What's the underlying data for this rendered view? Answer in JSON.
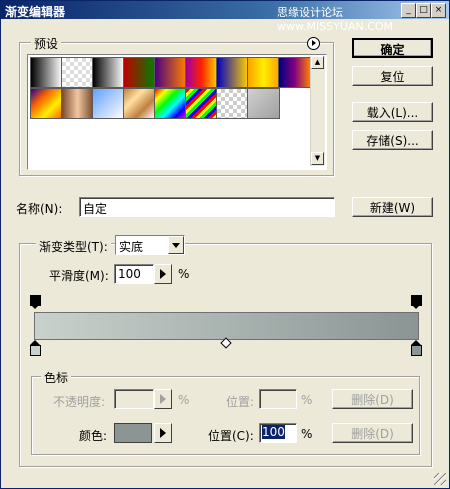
{
  "window": {
    "title": "渐变编辑器",
    "watermark": "思缘设计论坛  www.MISSYUAN.COM",
    "controls": {
      "minimize": "_",
      "maximize": "□",
      "close": "×"
    }
  },
  "presets": {
    "label": "预设",
    "menu_icon": "circle-arrow-icon",
    "swatches": [
      "linear-gradient(to right,#000,#fff)",
      "repeating-conic-gradient(#ddd 0 25%,#fff 0 50%) 0 0/8px 8px",
      "linear-gradient(to right,#000,#fff)",
      "linear-gradient(to right,#c00000,#008000)",
      "linear-gradient(to right,#4b0082,#ff7f00)",
      "linear-gradient(to right,#a000a0,#ff2000,#ffd000)",
      "linear-gradient(to right,#0000c0,#ffd000)",
      "linear-gradient(to right,#ffa000,#ffee00,#ffa000)",
      "linear-gradient(to right,#000080,#800080,#ff8000)",
      "linear-gradient(135deg,#2000a0,#ff6000,#fff000,#ff6000)",
      "linear-gradient(to right,#7b4a2d,#f0c8a0,#7b4a2d)",
      "linear-gradient(135deg,#60a0ff,#fff)",
      "linear-gradient(135deg,#c08040,#ffe0a0,#c08040,#fff)",
      "linear-gradient(135deg,#f00,#ff0,#0f0,#0ff,#00f,#f0f)",
      "repeating-linear-gradient(135deg,#f00 0 3px,#ff0 3px 6px,#0f0 6px 9px,#00f 9px 12px)",
      "repeating-conic-gradient(#ccc 0 25%,#fff 0 50%) 0 0/8px 8px",
      "linear-gradient(135deg,#d0d0d0,#a0a0a0)"
    ]
  },
  "buttons": {
    "ok": "确定",
    "reset": "复位",
    "load": "载入(L)...",
    "save": "存储(S)...",
    "new": "新建(W)"
  },
  "name": {
    "label": "名称(N):",
    "value": "自定"
  },
  "gradient": {
    "type_label": "渐变类型(T):",
    "type_value": "实底",
    "smoothness_label": "平滑度(M):",
    "smoothness_value": "100",
    "smoothness_unit": "%",
    "start_color": "#c9d1cc",
    "end_color": "#8a9594"
  },
  "stops": {
    "label": "色标",
    "opacity_label": "不透明度:",
    "opacity_unit": "%",
    "opacity_location_label": "位置:",
    "opacity_location_unit": "%",
    "opacity_delete": "删除(D)",
    "color_label": "颜色:",
    "color_value": "#8a9594",
    "color_location_label": "位置(C):",
    "color_location_value": "100",
    "color_location_unit": "%",
    "color_delete": "删除(D)"
  }
}
